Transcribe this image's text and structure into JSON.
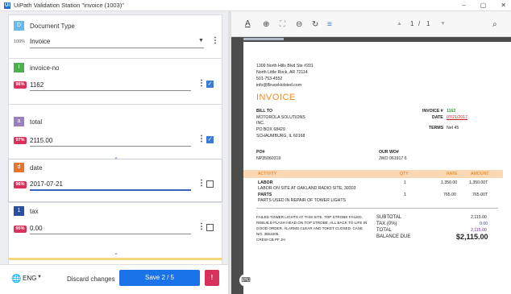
{
  "window": {
    "app_icon": "Ui",
    "title": "UiPath Validation Station \"invoice (1003)\"",
    "controls": [
      "–",
      "▢",
      "✕"
    ]
  },
  "doc_type_card": {
    "badge": "D",
    "label": "Document Type",
    "confidence": "100%",
    "value": "Invoice"
  },
  "fields": [
    {
      "badge": "I",
      "label": "invoice-no",
      "confidence": "96%",
      "value": "1162",
      "checked": true,
      "color": "#4caf50"
    },
    {
      "badge": "a",
      "label": "total",
      "confidence": "97%",
      "value": "2115.00",
      "checked": true,
      "color": "#9c7fbf"
    },
    {
      "badge": "d",
      "label": "date",
      "confidence": "96%",
      "value": "2017-07-21",
      "checked": false,
      "color": "#e8742c"
    },
    {
      "badge": "1",
      "label": "tax",
      "confidence": "95%",
      "value": "0.00",
      "checked": false,
      "color": "#2b4fa0"
    }
  ],
  "bottom": {
    "language": "ENG",
    "discard_label": "Discard changes",
    "save_label": "Save 2 / 5",
    "error_count": "!"
  },
  "viewer": {
    "page_current": "1",
    "page_sep": "/",
    "page_total": "1"
  },
  "invoice": {
    "address": [
      "1309 North Hills Blvd Ste #201",
      "North Little Rock, AR 72114",
      "501-753-4552",
      "info@BruceHolsted.com"
    ],
    "title": "INVOICE",
    "bill_to_label": "BILL TO",
    "bill_to": [
      "MOTOROLA SOLUTIONS",
      "INC.",
      "PO BOX 68429",
      "SCHAUMBURG, IL 60168"
    ],
    "invoice_no_label": "INVOICE #",
    "invoice_no": "1162",
    "date_label": "DATE",
    "date": "07/21/2017",
    "terms_label": "TERMS",
    "terms": "Net 45",
    "po_label": "PO#",
    "po": "NP35060319",
    "our_wo_label": "OUR WO#",
    "our_wo": "JWO 061917 6",
    "columns": [
      "ACTIVITY",
      "QTY",
      "RATE",
      "AMOUNT"
    ],
    "lines": [
      {
        "item": "LABOR",
        "desc": "LABOR ON SITE AT OAKLAND RADIO SITE, 30303",
        "qty": "1",
        "rate": "1,350.00",
        "amount": "1,350.00T"
      },
      {
        "item": "PARTS",
        "desc": "PARTS USED IN REPAIR OF TOWER LIGHTS",
        "qty": "1",
        "rate": "765.00",
        "amount": "765.00T"
      }
    ],
    "note": [
      "FAILED TOWER LIGHTS AT THIS SITE.  TOP STROBE FAILED,",
      "REBUILD FLASH HEAD ON TOP STROBE. ALL BACK TO LIFE IN",
      "GOOD ORDER. ALARMS CLEAR AND TOKET CLOSED. CASE",
      "NO. 3553405.",
      "CREW CB PF JH"
    ],
    "subtotal_label": "SUBTOTAL",
    "subtotal": "2,115.00",
    "tax_label": "TAX (0%)",
    "tax": "0.00",
    "total_label": "TOTAL",
    "total": "2,115.00",
    "balance_label": "BALANCE DUE",
    "balance": "$2,115.00"
  }
}
